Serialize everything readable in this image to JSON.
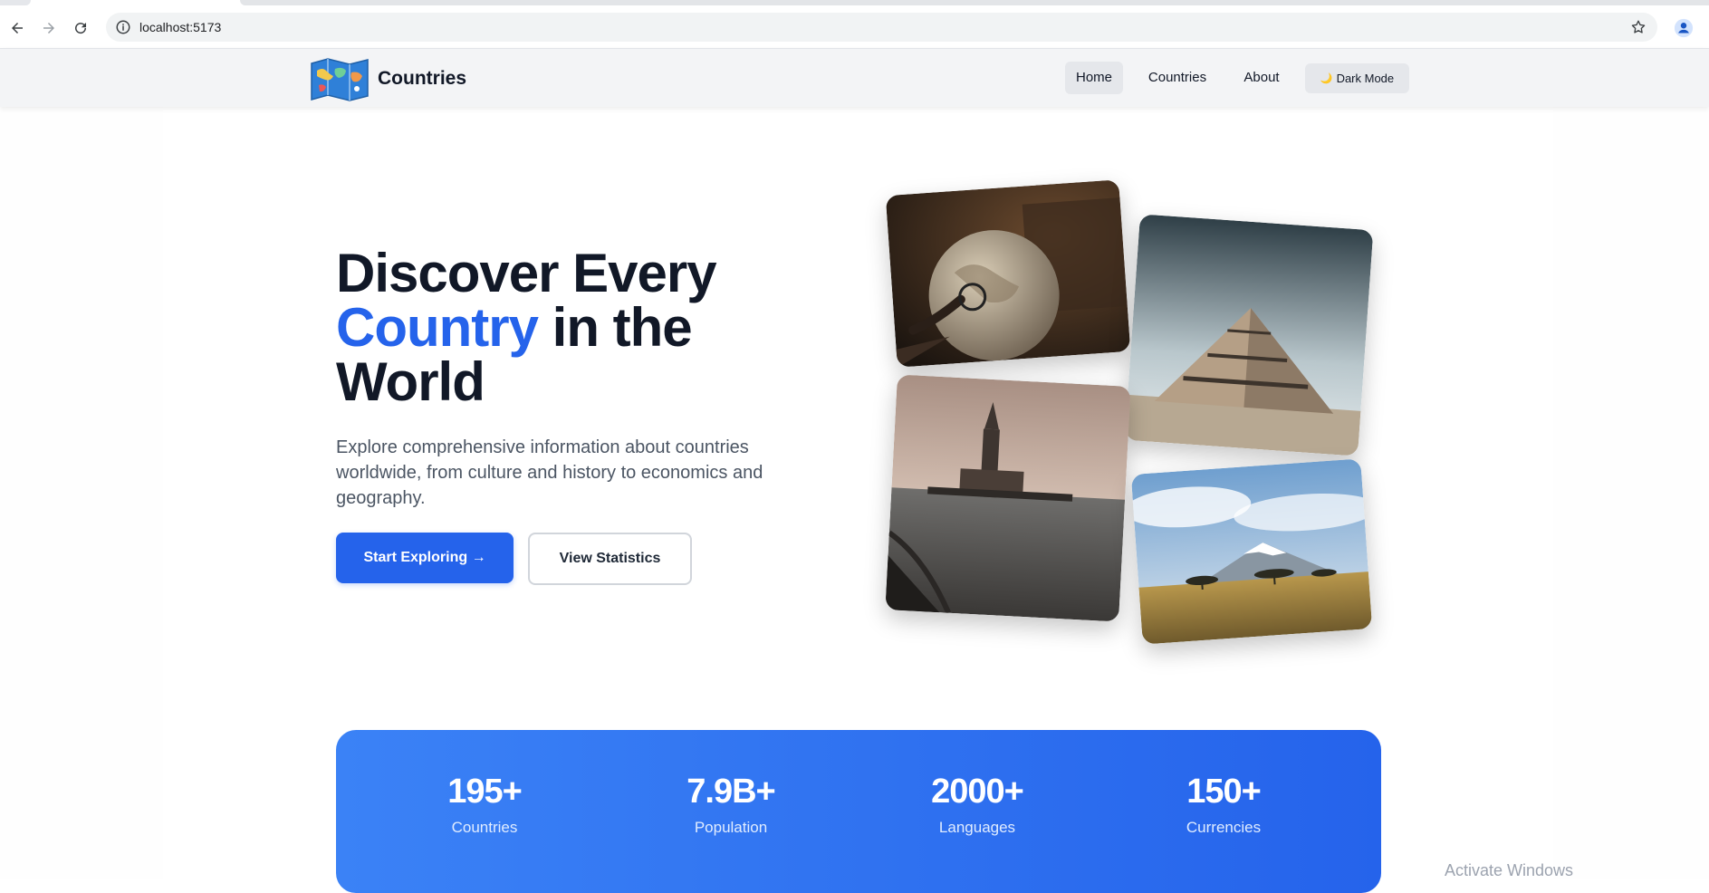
{
  "browser": {
    "url": "localhost:5173",
    "icons": [
      "back-icon",
      "forward-icon",
      "reload-icon",
      "info-icon",
      "star-icon",
      "profile-icon"
    ]
  },
  "navbar": {
    "brand": "Countries",
    "links": [
      {
        "label": "Home",
        "active": true
      },
      {
        "label": "Countries",
        "active": false
      },
      {
        "label": "About",
        "active": false
      }
    ],
    "dark_mode_icon": "🌙",
    "dark_mode_label": "Dark Mode"
  },
  "hero": {
    "title_line1": "Discover Every",
    "title_accent": "Country",
    "title_rest": " in the",
    "title_line3": "World",
    "subtitle": "Explore comprehensive information about countries worldwide, from culture and history to economics and geography.",
    "primary_button": "Start Exploring →",
    "secondary_button": "View Statistics"
  },
  "gallery": {
    "images": [
      "globe-photo",
      "pyramid-photo",
      "maidens-tower-photo",
      "kilimanjaro-photo"
    ]
  },
  "stats": [
    {
      "value": "195+",
      "label": "Countries"
    },
    {
      "value": "7.9B+",
      "label": "Population"
    },
    {
      "value": "2000+",
      "label": "Languages"
    },
    {
      "value": "150+",
      "label": "Currencies"
    }
  ],
  "system": {
    "watermark": "Activate Windows"
  },
  "colors": {
    "accent": "#2563eb",
    "stats_gradient_start": "#3b82f6",
    "stats_gradient_end": "#2563eb",
    "navbar_bg": "#f3f4f6"
  }
}
